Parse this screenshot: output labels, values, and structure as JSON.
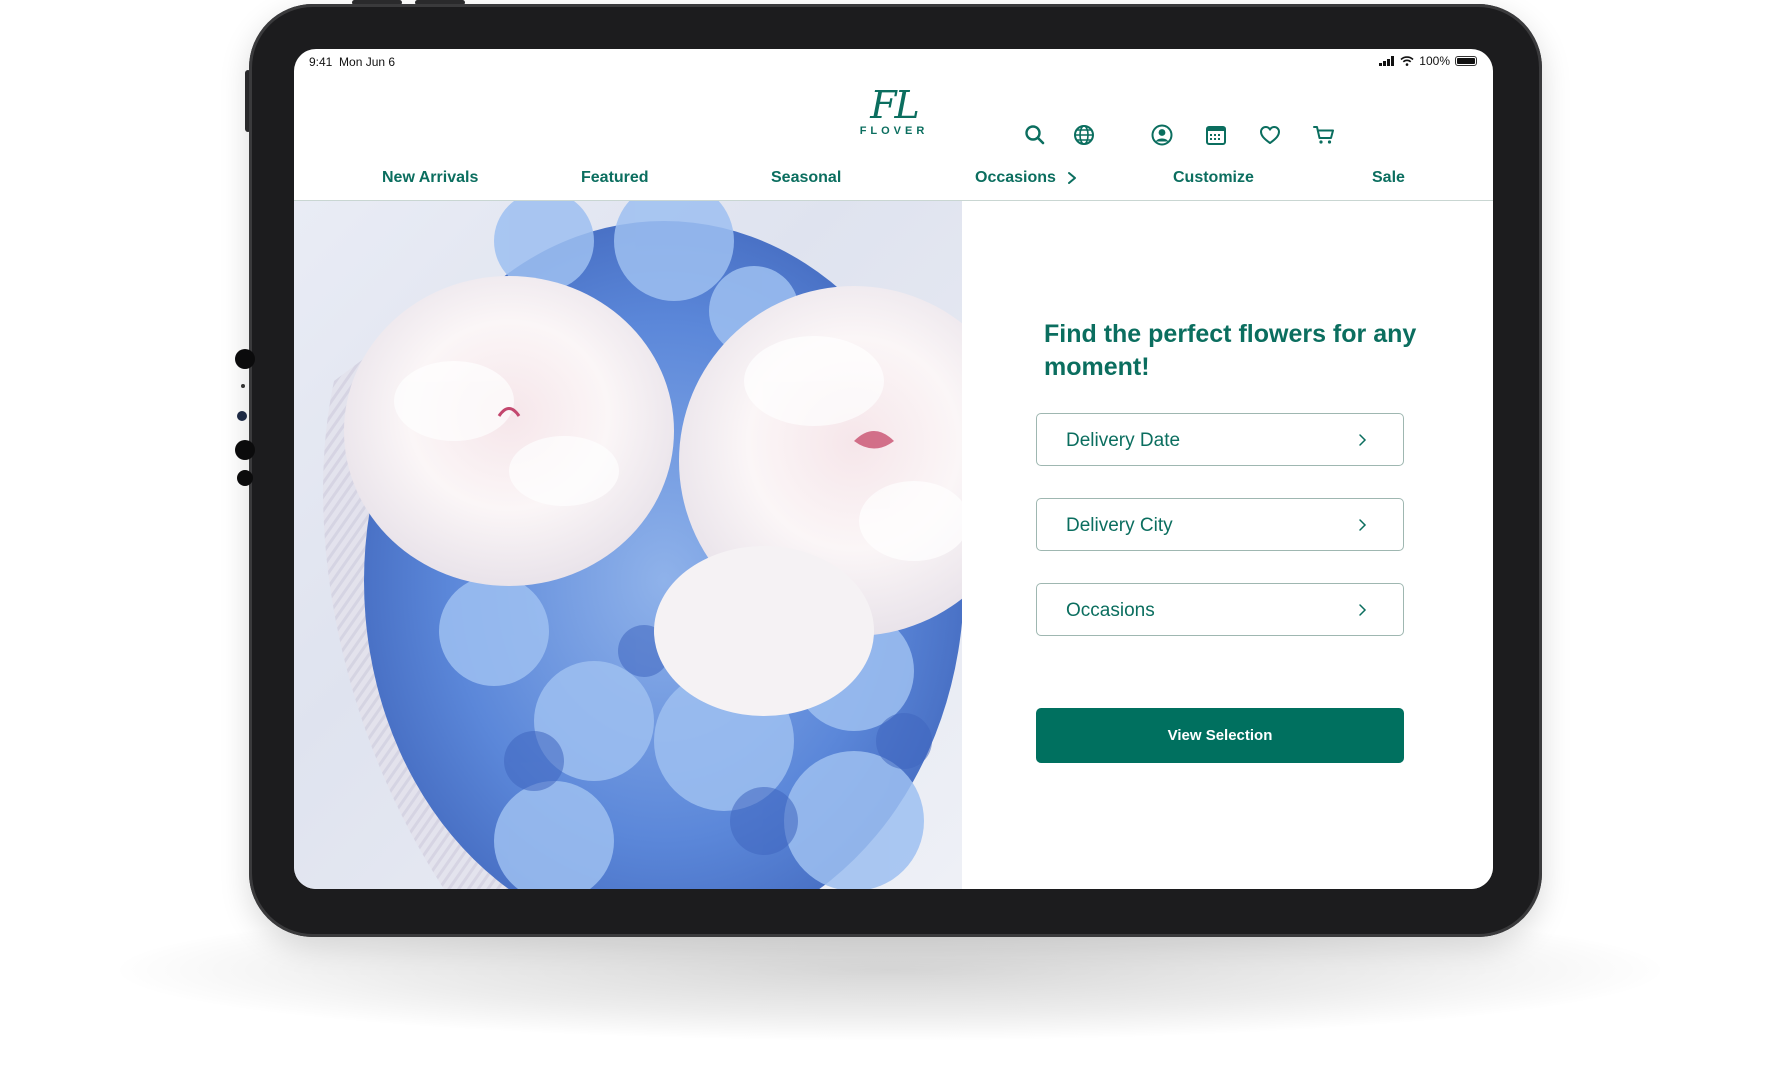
{
  "status_bar": {
    "time": "9:41",
    "date": "Mon Jun 6",
    "battery": "100%"
  },
  "brand": {
    "monogram": "FL",
    "wordmark": "FLOVER"
  },
  "header_icons": [
    "search-icon",
    "globe-icon",
    "account-icon",
    "calendar-icon",
    "heart-icon",
    "cart-icon"
  ],
  "nav": {
    "items": [
      {
        "label": "New Arrivals"
      },
      {
        "label": "Featured"
      },
      {
        "label": "Seasonal"
      },
      {
        "label": "Occasions"
      },
      {
        "label": "Customize"
      },
      {
        "label": "Sale"
      }
    ]
  },
  "finder": {
    "headline": "Find the perfect flowers for any moment!",
    "fields": [
      {
        "label": "Delivery Date"
      },
      {
        "label": "Delivery City"
      },
      {
        "label": "Occasions"
      }
    ],
    "cta_label": "View Selection"
  },
  "colors": {
    "brand": "#0b6e5f",
    "cta": "#00705f",
    "border": "#9fb7b1"
  }
}
